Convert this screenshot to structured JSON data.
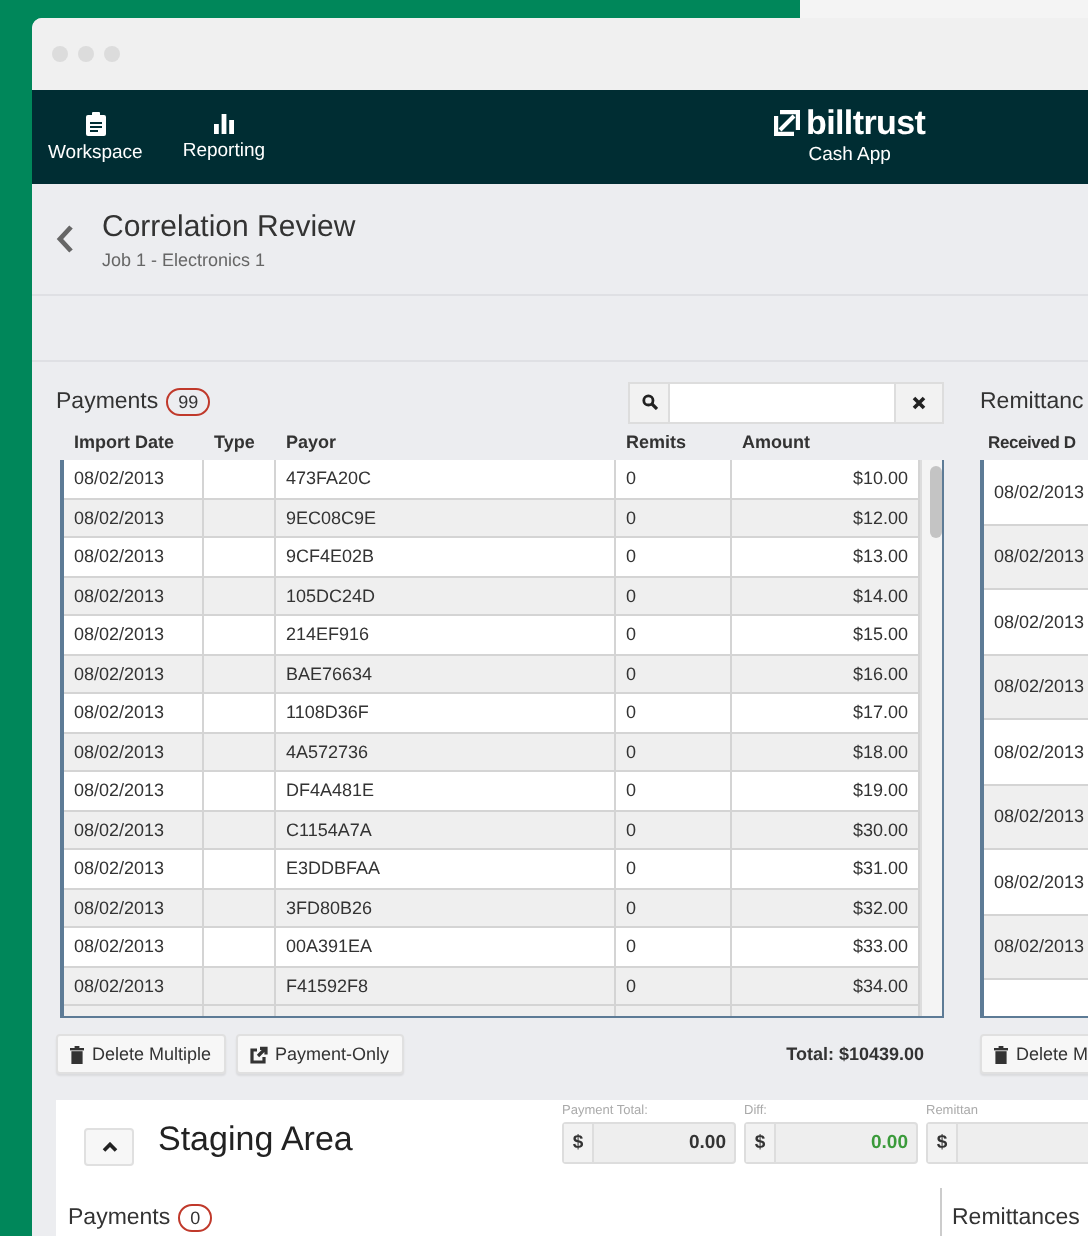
{
  "nav": {
    "items": [
      {
        "label": "Workspace",
        "kind": "clipboard"
      },
      {
        "label": "Reporting",
        "kind": "chart"
      }
    ],
    "brand": "billtrust",
    "app": "Cash App"
  },
  "header": {
    "title": "Correlation Review",
    "subtitle": "Job 1 - Electronics 1"
  },
  "payments": {
    "title": "Payments",
    "count": "99",
    "columns": [
      "Import Date",
      "Type",
      "Payor",
      "Remits",
      "Amount"
    ],
    "rows": [
      {
        "import_date": "08/02/2013",
        "type": "",
        "payor": "473FA20C",
        "remits": "0",
        "amount": "$10.00"
      },
      {
        "import_date": "08/02/2013",
        "type": "",
        "payor": "9EC08C9E",
        "remits": "0",
        "amount": "$12.00"
      },
      {
        "import_date": "08/02/2013",
        "type": "",
        "payor": "9CF4E02B",
        "remits": "0",
        "amount": "$13.00"
      },
      {
        "import_date": "08/02/2013",
        "type": "",
        "payor": "105DC24D",
        "remits": "0",
        "amount": "$14.00"
      },
      {
        "import_date": "08/02/2013",
        "type": "",
        "payor": "214EF916",
        "remits": "0",
        "amount": "$15.00"
      },
      {
        "import_date": "08/02/2013",
        "type": "",
        "payor": "BAE76634",
        "remits": "0",
        "amount": "$16.00"
      },
      {
        "import_date": "08/02/2013",
        "type": "",
        "payor": "1108D36F",
        "remits": "0",
        "amount": "$17.00"
      },
      {
        "import_date": "08/02/2013",
        "type": "",
        "payor": "4A572736",
        "remits": "0",
        "amount": "$18.00"
      },
      {
        "import_date": "08/02/2013",
        "type": "",
        "payor": "DF4A481E",
        "remits": "0",
        "amount": "$19.00"
      },
      {
        "import_date": "08/02/2013",
        "type": "",
        "payor": "C1154A7A",
        "remits": "0",
        "amount": "$30.00"
      },
      {
        "import_date": "08/02/2013",
        "type": "",
        "payor": "E3DDBFAA",
        "remits": "0",
        "amount": "$31.00"
      },
      {
        "import_date": "08/02/2013",
        "type": "",
        "payor": "3FD80B26",
        "remits": "0",
        "amount": "$32.00"
      },
      {
        "import_date": "08/02/2013",
        "type": "",
        "payor": "00A391EA",
        "remits": "0",
        "amount": "$33.00"
      },
      {
        "import_date": "08/02/2013",
        "type": "",
        "payor": "F41592F8",
        "remits": "0",
        "amount": "$34.00"
      }
    ],
    "buttons": [
      {
        "label": "Delete Multiple",
        "kind": "delete"
      },
      {
        "label": "Payment-Only",
        "kind": "share"
      }
    ],
    "total": "Total: $10439.00"
  },
  "remittances": {
    "title": "Remittanc",
    "columns": [
      "Received D"
    ],
    "rows": [
      "08/02/2013",
      "08/02/2013",
      "08/02/2013",
      "08/02/2013",
      "08/02/2013",
      "08/02/2013",
      "08/02/2013",
      "08/02/2013"
    ],
    "buttons": [
      {
        "label": "Delete M",
        "kind": "delete"
      }
    ]
  },
  "staging": {
    "title": "Staging Area",
    "fields": [
      {
        "label": "Payment Total:",
        "currency": "$",
        "value": "0.00",
        "kind": "plain"
      },
      {
        "label": "Diff:",
        "currency": "$",
        "value": "0.00",
        "kind": "diff"
      },
      {
        "label": "Remittan",
        "currency": "$",
        "kind": "plain"
      }
    ],
    "payments": {
      "title": "Payments",
      "count": "0"
    },
    "remittances": {
      "title": "Remittances"
    }
  }
}
